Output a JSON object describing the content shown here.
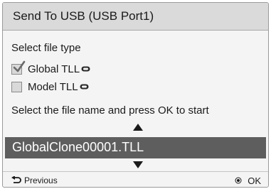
{
  "dialog": {
    "title": "Send To USB (USB Port1)",
    "section_label": "Select file type",
    "options": [
      {
        "label": "Global TLL",
        "checked": true,
        "icon": "link-icon"
      },
      {
        "label": "Model TLL",
        "checked": false,
        "icon": "link-icon"
      }
    ],
    "instruction": "Select the file name and press OK to start",
    "file_selector": {
      "selected_file": "GlobalClone00001.TLL",
      "up_icon": "triangle-up-icon",
      "down_icon": "triangle-down-icon"
    },
    "footer": {
      "previous_label": "Previous",
      "previous_icon": "return-arrow-icon",
      "ok_label": "OK",
      "ok_icon": "ok-dot-icon"
    }
  },
  "colors": {
    "title_bar": "#dadada",
    "panel": "#f4f4f4",
    "selection_bar": "#5e5e5e",
    "selection_text": "#ffffff"
  }
}
